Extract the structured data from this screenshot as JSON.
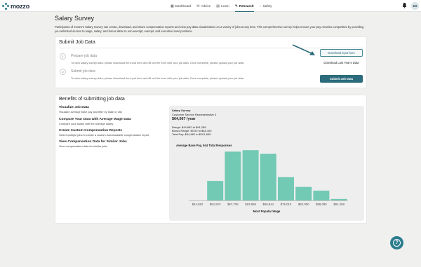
{
  "brand": {
    "name": "mozzo"
  },
  "nav": {
    "items": [
      {
        "label": "Dashboard",
        "icon": "dashboard-icon",
        "glyph": "▦"
      },
      {
        "label": "Advice",
        "icon": "chat-icon",
        "glyph": "✉"
      },
      {
        "label": "Learn",
        "icon": "book-icon",
        "glyph": "▤"
      },
      {
        "label": "Research",
        "icon": "research-icon",
        "glyph": "✎",
        "active": true
      },
      {
        "label": "Safety",
        "icon": "shield-icon",
        "glyph": "◌"
      }
    ],
    "avatar_initials": "DS"
  },
  "page": {
    "title": "Salary Survey",
    "intro": "Participants of mozzo's Salary Survey can create, download, and share compensation reports and view pay data visualizations on a variety of jobs at any time. This comprehensive survey helps ensure your pay remains competitive by providing you unlimited access to wage, salary, and bonus data on non-exempt, exempt, and executive level positions."
  },
  "submit_card": {
    "title": "Submit Job Data",
    "steps": [
      {
        "num": "1",
        "title": "Prepare job data",
        "desc": "To view salary survey data, please download the input form and fill out the form with your job data. Once complete, please upload your job data."
      },
      {
        "num": "2",
        "title": "Submit job data",
        "desc": "To view salary survey data, please download the input form and fill out the form with your job data. Once complete, please upload your job data."
      }
    ],
    "download_input_label": "Download input form",
    "download_last_label": "Download Last Year's Data",
    "submit_label": "Submit Job Data"
  },
  "benefits_card": {
    "title": "Benefits of submitting job data",
    "items": [
      {
        "title": "Visualize Job Data",
        "desc": "Visualize average base pay and filter by state or city."
      },
      {
        "title": "Compare Your Data with Average Wage Data",
        "desc": "Compare your salary with the average salary."
      },
      {
        "title": "Create Custom Compensation Reports",
        "desc": "Select multiple jobs to create a custom downloadable compensation report."
      },
      {
        "title": "View Compensation Data for Similar Jobs",
        "desc": "View compensation data for similar jobs."
      }
    ]
  },
  "survey_panel": {
    "title": "Salary Survey",
    "job": "Customer Service Representative 3",
    "salary": "$64,067 /year",
    "range": "Range: $44,682 to $91,258",
    "bonus": "Bonus Range: $0.00 to $48,100",
    "total": "Total Pay: $44,682 to $101,655"
  },
  "chart_data": {
    "type": "bar",
    "title": "Average Base Pay, 944 Total Responses",
    "xlabel": "Most Popular Wage",
    "ylabel": "",
    "categories": [
      "$44,682",
      "$51,923",
      "$57,708",
      "$63,859",
      "$69,844",
      "$76,010",
      "$82,050",
      "$88,090",
      "$91,258"
    ],
    "values": [
      0,
      130,
      325,
      335,
      310,
      155,
      90,
      65,
      10
    ],
    "ylim": [
      0,
      350
    ],
    "color": "#72c9b4",
    "grid": false
  },
  "colors": {
    "accent": "#2b6b7b",
    "bar": "#72c9b4",
    "background": "#f0f0ef"
  }
}
